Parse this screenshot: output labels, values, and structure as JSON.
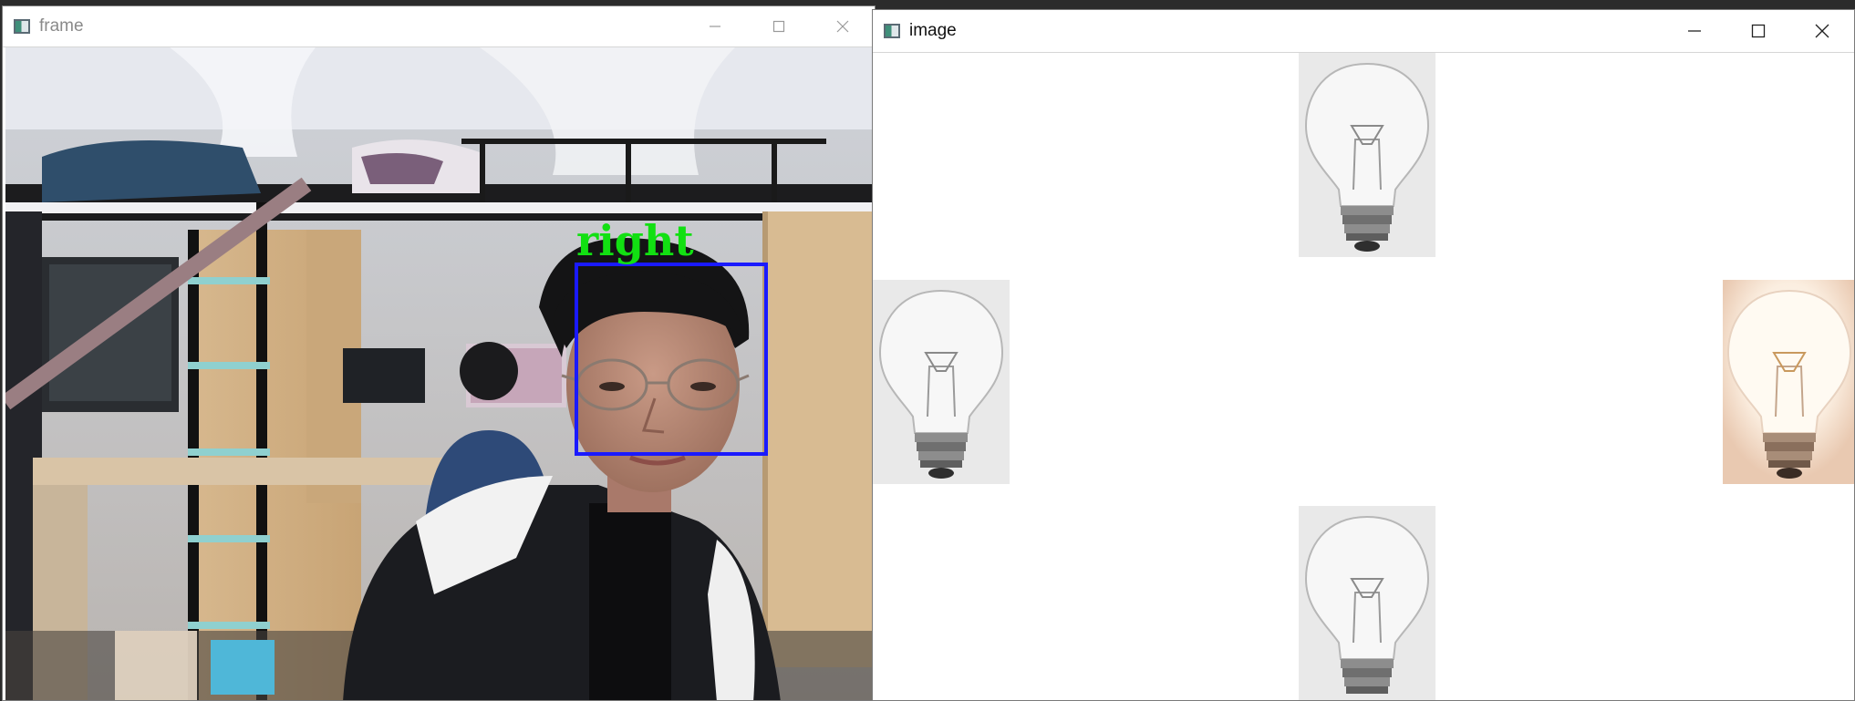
{
  "frame_window": {
    "title": "frame",
    "icon": "window-app-icon",
    "controls": [
      "minimize-icon",
      "maximize-icon",
      "close-icon"
    ],
    "detection": {
      "label": "right",
      "box_color": "#1a1aff",
      "label_color": "#12e012"
    }
  },
  "image_window": {
    "title": "image",
    "icon": "window-app-icon",
    "controls": [
      "minimize-icon",
      "maximize-icon",
      "close-icon"
    ],
    "bulbs": [
      {
        "position": "top",
        "state": "off"
      },
      {
        "position": "left",
        "state": "off"
      },
      {
        "position": "right",
        "state": "on"
      },
      {
        "position": "bottom",
        "state": "off"
      }
    ],
    "colors": {
      "bulb_off_bg": "#e8e8e8",
      "bulb_on_bg": "#f6e2d0"
    }
  }
}
